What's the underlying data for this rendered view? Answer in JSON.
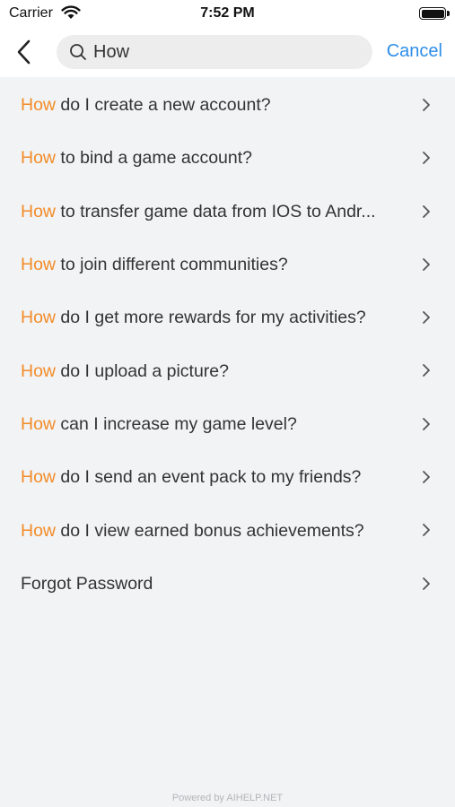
{
  "status_bar": {
    "carrier": "Carrier",
    "time": "7:52 PM"
  },
  "nav": {
    "search_value": "How",
    "cancel_label": "Cancel"
  },
  "highlight_color": "#f28c28",
  "accent_color": "#2f8ee8",
  "faq_items": [
    {
      "highlight": "How",
      "rest": " do I create a new account?"
    },
    {
      "highlight": "How",
      "rest": " to bind a game account?"
    },
    {
      "highlight": "How",
      "rest": " to transfer game data from IOS to Andr..."
    },
    {
      "highlight": "How",
      "rest": " to join different communities?"
    },
    {
      "highlight": "How",
      "rest": " do I get more rewards for my activities?"
    },
    {
      "highlight": "How",
      "rest": " do I upload a picture?"
    },
    {
      "highlight": "How",
      "rest": " can I increase my game level?"
    },
    {
      "highlight": "How",
      "rest": " do I send an event pack to my friends?"
    },
    {
      "highlight": "How",
      "rest": " do I view earned bonus achievements?"
    },
    {
      "highlight": "",
      "rest": "Forgot Password"
    }
  ],
  "footer": {
    "text": "Powered by AIHELP.NET"
  }
}
